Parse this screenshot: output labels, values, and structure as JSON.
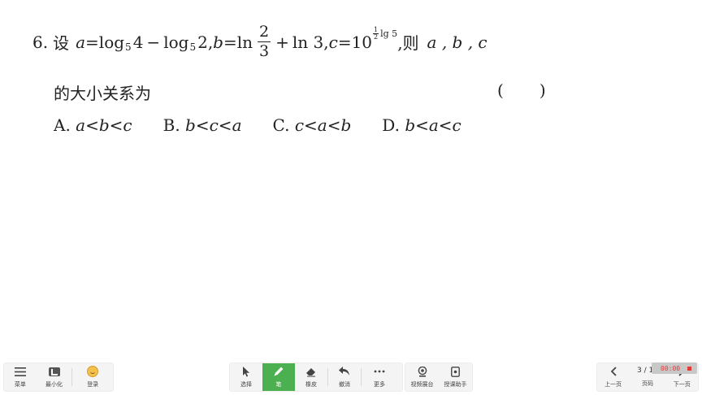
{
  "question": {
    "number": "6.",
    "lead": "设",
    "a_var": "a",
    "eq1": "=",
    "log1": "log",
    "log1_base": "5",
    "log1_arg": "4",
    "minus": "−",
    "log2": "log",
    "log2_base": "5",
    "log2_arg": "2",
    "comma1": ",",
    "b_var": "b",
    "eq2": "=",
    "ln1": "ln",
    "frac_num": "2",
    "frac_den": "3",
    "plus": "+",
    "ln2": "ln 3",
    "comma2": ",",
    "c_var": "c",
    "eq3": "=",
    "ten": "10",
    "exp_num": "1",
    "exp_den": "2",
    "exp_lg": "lg 5",
    "tail": ",则",
    "vars": "a , b , c",
    "line2": "的大小关系为",
    "paren_open": "(",
    "paren_close": ")"
  },
  "choices": [
    {
      "label": "A.",
      "expr": "a<b<c"
    },
    {
      "label": "B.",
      "expr": "b<c<a"
    },
    {
      "label": "C.",
      "expr": "c<a<b"
    },
    {
      "label": "D.",
      "expr": "b<a<c"
    }
  ],
  "toolbar": {
    "menu": "菜单",
    "minimize": "最小化",
    "login": "登录",
    "select": "选择",
    "pen": "笔",
    "eraser": "橡皮",
    "undo": "撤消",
    "more": "更多",
    "video_booth": "视频展台",
    "teaching_assistant": "授课助手",
    "prev_page": "上一页",
    "page_num": "3 / 13",
    "page_label": "页码",
    "next_page": "下一页",
    "timer": "00:00"
  },
  "colors": {
    "active_tool": "#4caf50",
    "timer_text": "#e53935"
  }
}
